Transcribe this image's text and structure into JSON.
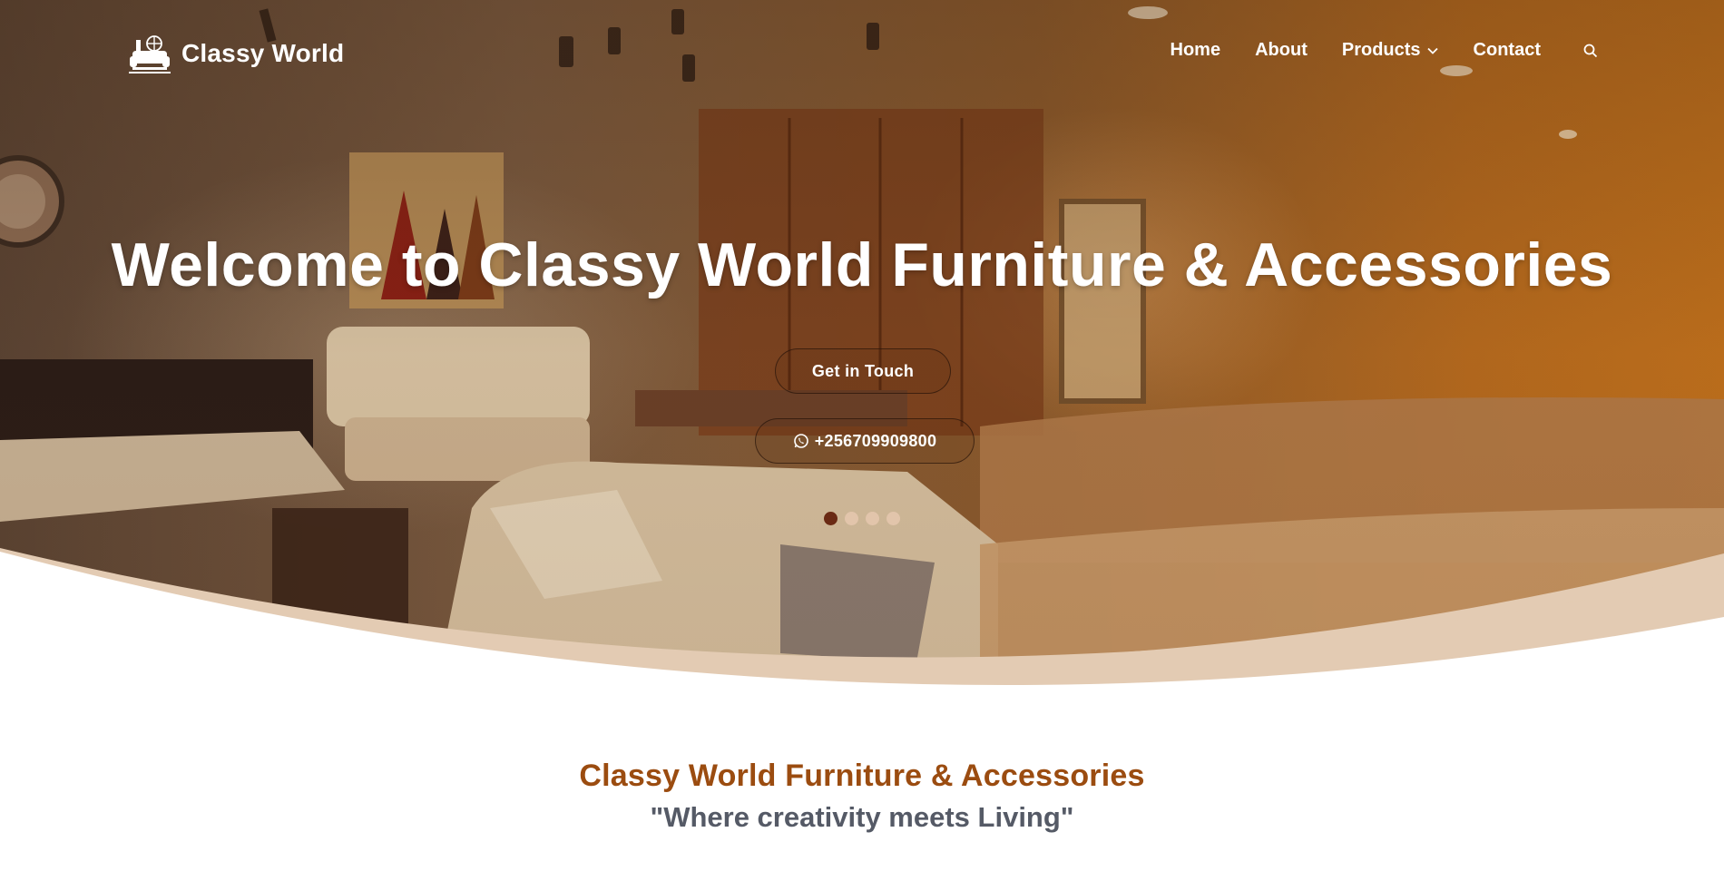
{
  "brand": {
    "name": "Classy World"
  },
  "nav": {
    "items": [
      {
        "label": "Home",
        "active": true
      },
      {
        "label": "About"
      },
      {
        "label": "Products",
        "has_dropdown": true
      },
      {
        "label": "Contact"
      }
    ]
  },
  "hero": {
    "title": "Welcome to Classy World Furniture & Accessories",
    "cta_label": "Get in Touch",
    "phone_label": "+256709909800",
    "slides_total": 4,
    "active_slide": 1
  },
  "intro": {
    "title": "Classy World Furniture & Accessories",
    "tagline": "\"Where creativity meets Living\""
  },
  "colors": {
    "accent": "#9b4c10",
    "tagline": "#555a66",
    "active_dot": "#6a2a14",
    "curve": "#e3cbb3"
  },
  "icons": [
    "logo-armchair-icon",
    "chevron-down-icon",
    "search-icon",
    "whatsapp-icon"
  ]
}
